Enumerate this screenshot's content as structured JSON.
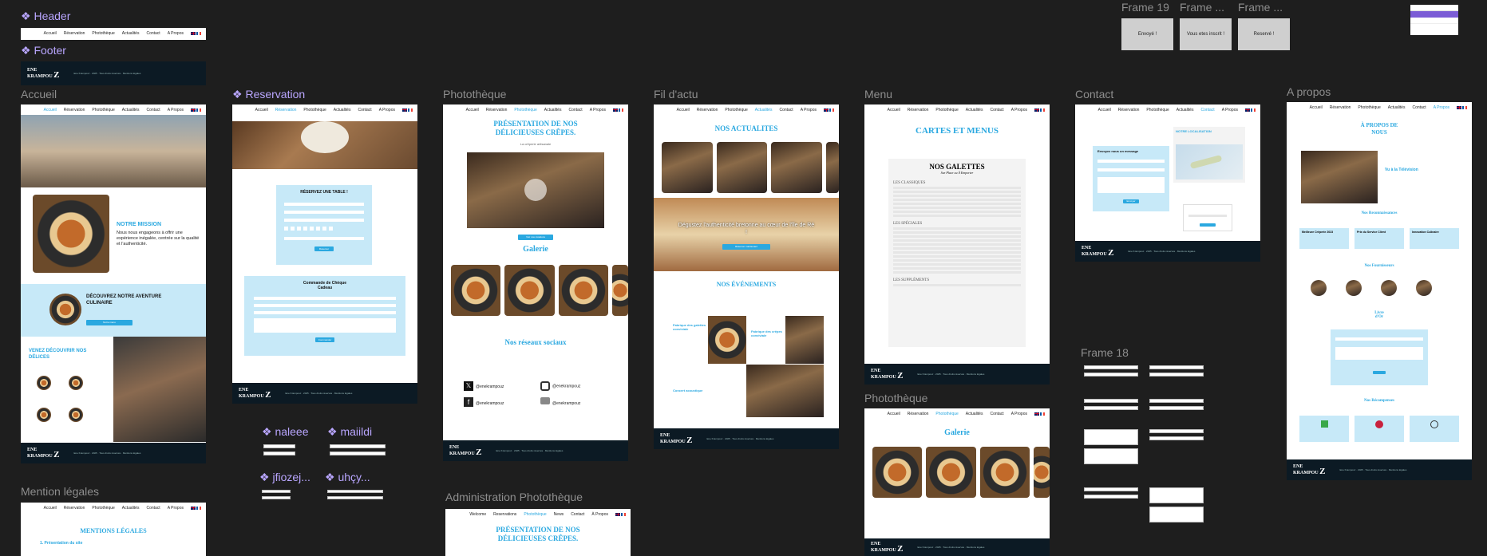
{
  "components": {
    "header": "Header",
    "footer": "Footer",
    "naleee": "naleee",
    "mailildi": "maiildi",
    "jfiozej": "jfiozej...",
    "uhcy": "uhçy..."
  },
  "frames": {
    "accueil": "Accueil",
    "reservation": "Reservation",
    "phototheque": "Photothèque",
    "fil": "Fil d'actu",
    "menu": "Menu",
    "contact": "Contact",
    "apropos": "A propos",
    "mention": "Mention légales",
    "admin": "Administration Photothèque",
    "phototheque2": "Photothèque",
    "frame18": "Frame 18",
    "frame19": "Frame 19",
    "frame_a": "Frame ...",
    "frame_b": "Frame ..."
  },
  "nav": {
    "accueil": "Accueil",
    "reservation": "Réservation",
    "phototheque": "Photothèque",
    "actualites": "Actualités",
    "contact": "Contact",
    "apropos": "A Propos",
    "welcome": "Welcome",
    "reservations": "Reservations",
    "photo": "Photothèque",
    "news": "News",
    "contact2": "Contact",
    "about": "À Propos"
  },
  "brand": {
    "l1": "ENE",
    "l2": "KRAMPOU",
    "z": "Z"
  },
  "footer_text": "Ene Krampouz · 2025 · Tous droits réservés · Mentions légales",
  "status": {
    "envoye": "Envoyé !",
    "inscrit": "Vous etes inscrit !",
    "reserve": "Reservé !"
  },
  "accueil": {
    "mission_title": "NOTRE MISSION",
    "mission_text": "Nous nous engageons à offrir une expérience inégalée, centrée sur la qualité et l'authenticité.",
    "aventure_title": "DÉCOUVREZ NOTRE AVENTURE CULINAIRE",
    "aventure_btn": "Notre menu",
    "delices_title": "VENEZ DÉCOUVRIR NOS DÉLICES"
  },
  "reservation": {
    "title": "RÉSERVEZ UNE TABLE !",
    "btn": "Réserver",
    "cheque_title": "Commande de Chèque Cadeau",
    "cheque_btn": "Commander"
  },
  "phototheque": {
    "title": "PRÉSENTATION DE NOS DÉLICIEUSES CRÊPES.",
    "subtitle": "La crêperie artisanale",
    "btn": "Voir nos créations",
    "galerie": "Galerie",
    "reseaux": "Nos réseaux sociaux",
    "handle": "@enekrampouz"
  },
  "fil": {
    "title": "NOS ACTUALITES",
    "banner": "Dégustez l'authenticité bretonne au cœur de l'île de Ré !",
    "btn": "Réserver maintenant",
    "events": "NOS ÉVÉNEMENTS",
    "ev1": "Fabrique des galettes conviviale",
    "ev2": "Fabrique des crêpes conviviale",
    "ev3": "Concert acoustique"
  },
  "menu": {
    "title": "CARTES ET MENUS",
    "card_title": "NOS GALETTES",
    "card_sub": "Sur Place ou À Emporter",
    "s1": "LES CLASSIQUES",
    "s2": "LES SPÉCIALES",
    "s3": "LES SUPPLÉMENTS",
    "galerie": "Galerie"
  },
  "contact": {
    "form_title": "Envoyez nous un message",
    "loc_title": "NOTRE LOCALISATION",
    "btn": "Envoyer"
  },
  "apropos": {
    "title": "À PROPOS DE NOUS",
    "tele": "Vu à la Télévision",
    "reco": "Nos Reconnaissances",
    "r1": "Meilleure Crêperie 2023",
    "r2": "Prix du Service Client",
    "r3": "Innovation Culinaire",
    "four": "Nos Fournisseurs",
    "livre": "Livre d'Or",
    "recomp": "Nos Récompenses"
  },
  "mention": {
    "title": "MENTIONS LÉGALES",
    "s1": "1. Présentation du site"
  },
  "admin": {
    "title": "PRÉSENTATION DE NOS DÉLICIEUSES CRÊPES."
  }
}
